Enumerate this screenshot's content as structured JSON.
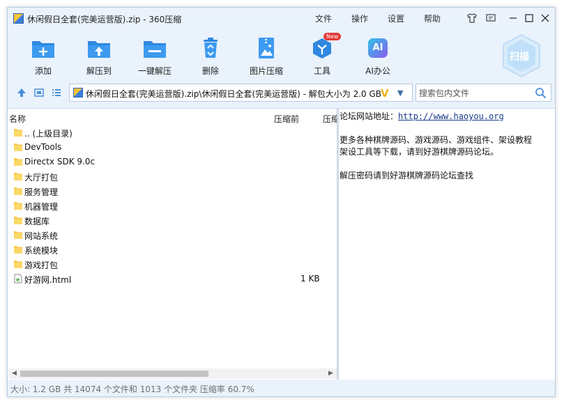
{
  "window": {
    "title": "休闲假日全套(完美运营版).zip - 360压缩",
    "menus": [
      "文件",
      "操作",
      "设置",
      "帮助"
    ]
  },
  "toolbar": {
    "tools": [
      {
        "label": "添加",
        "icon": "add-folder-icon"
      },
      {
        "label": "解压到",
        "icon": "extract-to-icon"
      },
      {
        "label": "一键解压",
        "icon": "one-click-extract-icon"
      },
      {
        "label": "删除",
        "icon": "recycle-bin-icon"
      },
      {
        "label": "图片压缩",
        "icon": "image-compress-icon"
      },
      {
        "label": "工具",
        "icon": "tools-cube-icon",
        "badge": "New"
      },
      {
        "label": "AI办公",
        "icon": "ai-office-icon",
        "icon_text": "AI"
      }
    ],
    "scan_label": "扫描"
  },
  "address": {
    "path": "休闲假日全套(完美运营版).zip\\休闲假日全套(完美运营版) - 解包大小为 2.0 GB",
    "search_placeholder": "搜索包内文件"
  },
  "file_list": {
    "columns": {
      "name": "名称",
      "packed": "压缩前",
      "more": "压缩"
    },
    "rows": [
      {
        "name": ".. (上级目录)",
        "type": "folder",
        "size": ""
      },
      {
        "name": "DevTools",
        "type": "folder",
        "size": ""
      },
      {
        "name": "Directx SDK 9.0c",
        "type": "folder",
        "size": ""
      },
      {
        "name": "大厅打包",
        "type": "folder",
        "size": ""
      },
      {
        "name": "服务管理",
        "type": "folder",
        "size": ""
      },
      {
        "name": "机器管理",
        "type": "folder",
        "size": ""
      },
      {
        "name": "数据库",
        "type": "folder",
        "size": ""
      },
      {
        "name": "网站系统",
        "type": "folder",
        "size": ""
      },
      {
        "name": "系统模块",
        "type": "folder",
        "size": ""
      },
      {
        "name": "游戏打包",
        "type": "folder",
        "size": ""
      },
      {
        "name": "好游网.html",
        "type": "html",
        "size": "1 KB"
      }
    ]
  },
  "note": {
    "line1_prefix": "论坛网站地址：",
    "line1_link": "http://www.haoyou.org",
    "line2": "更多各种棋牌源码、游戏源码、游戏组件、架设教程",
    "line3": "架设工具等下载，请到好游棋牌源码论坛。",
    "line4": "解压密码请到好游棋牌源码论坛查找"
  },
  "status": {
    "text": "大小: 1.2 GB 共 14074 个文件和 1013 个文件夹 压缩率 60.7%"
  },
  "colors": {
    "accent": "#2f87e0",
    "window_bg": "#eaf2fc",
    "folder": "#f7cb4d",
    "badge": "#e53935",
    "ai_gradient_start": "#2ec3e6",
    "ai_gradient_end": "#8a5cf0"
  }
}
